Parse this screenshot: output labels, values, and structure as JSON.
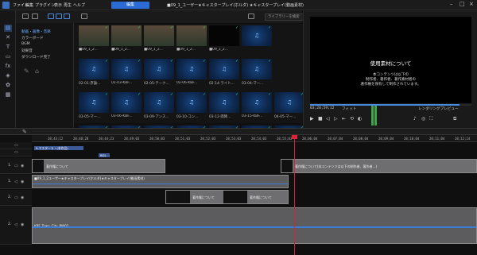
{
  "menubar": {
    "items": [
      "ファイル",
      "編集",
      "プラグイン",
      "表示",
      "再生",
      "ヘルプ"
    ],
    "edit_button": "編集",
    "project_title": "■09_1_ユーザー★キャスタープレイ(ホルダ) ★キャスタープレイ(動画素材)"
  },
  "categories": [
    "動画・画像・音楽",
    "カラーボード",
    "BGM",
    "効果音",
    "ダウンロード完了"
  ],
  "search": {
    "placeholder": "ライブラリーを検索"
  },
  "media_rows": [
    [
      {
        "label": "■09_1_2...",
        "kind": "video"
      },
      {
        "label": "■09_1_2...",
        "kind": "video"
      },
      {
        "label": "■09_1_2...",
        "kind": "video"
      },
      {
        "label": "■09_1_2...",
        "kind": "video"
      },
      {
        "label": "■09_1_2...",
        "kind": "black"
      },
      {
        "label": "",
        "kind": "music"
      }
    ],
    [
      {
        "label": "02-01-序論...",
        "kind": "music"
      },
      {
        "label": "02-03-KBF...",
        "kind": "music"
      },
      {
        "label": "02-05-テーク...",
        "kind": "music"
      },
      {
        "label": "02-06-KBF...",
        "kind": "music"
      },
      {
        "label": "02-14-ライト...",
        "kind": "music"
      },
      {
        "label": "03-04-マー...",
        "kind": "music"
      }
    ],
    [
      {
        "label": "03-05-マー...",
        "kind": "music"
      },
      {
        "label": "03-06-KBF...",
        "kind": "music"
      },
      {
        "label": "03-09-アンス...",
        "kind": "music"
      },
      {
        "label": "03-10-コン...",
        "kind": "music"
      },
      {
        "label": "03-12-雨降...",
        "kind": "music"
      },
      {
        "label": "03-15-KBF...",
        "kind": "music"
      },
      {
        "label": "04-05-マー...",
        "kind": "music"
      }
    ],
    [
      {
        "label": "",
        "kind": "music"
      },
      {
        "label": "",
        "kind": "music"
      },
      {
        "label": "",
        "kind": "music"
      },
      {
        "label": "",
        "kind": "music"
      },
      {
        "label": "",
        "kind": "music"
      },
      {
        "label": "",
        "kind": "music"
      },
      {
        "label": "",
        "kind": "music"
      }
    ]
  ],
  "preview": {
    "title": "使用素材について",
    "lines": [
      "本コンテンツは以下の",
      "制作者、著作者、著作素材者の",
      "著作権を保有して制作されています。"
    ],
    "timecode": "03;28;59;12",
    "fit": "フィット",
    "render_label": "レンダリングプレビュー"
  },
  "ruler": {
    "ticks": [
      "28;43;12",
      "28;48;28",
      "28;44;23",
      "28;49;03",
      "28;50;03",
      "28;51;03",
      "28;52;03",
      "28;53;03",
      "28;54;03",
      "28;55;03",
      "28;06;04",
      "28;07;04",
      "28;08;04",
      "28;09;04",
      "28;10;04",
      "28;11;04",
      "28;12;14"
    ]
  },
  "markers": [
    "9.マスターラ・(本作品)",
    "BGL"
  ],
  "tracks": [
    {
      "num": "1.",
      "clips": [
        {
          "label": "著作権について"
        },
        {
          "label": "著作権について"
        },
        {
          "label": "著作権について(本コンテンツは以下の制作者、著作者…)"
        }
      ]
    },
    {
      "num": "1.",
      "clips": [
        {
          "label": "■09_1_2ユーザー★キャスタープレイ(ホルダ)★キャスタープレイ(動画素材)"
        }
      ]
    },
    {
      "num": "2.",
      "clips": [
        {
          "label": "著作権について"
        },
        {
          "label": "著作権について"
        }
      ]
    },
    {
      "num": "2.",
      "clips": [
        {
          "label": "KBF_Town_City_BW02"
        }
      ]
    }
  ],
  "colors": {
    "accent": "#2b6bd6",
    "playhead": "#dd2233",
    "clip": "#6e6e70"
  }
}
